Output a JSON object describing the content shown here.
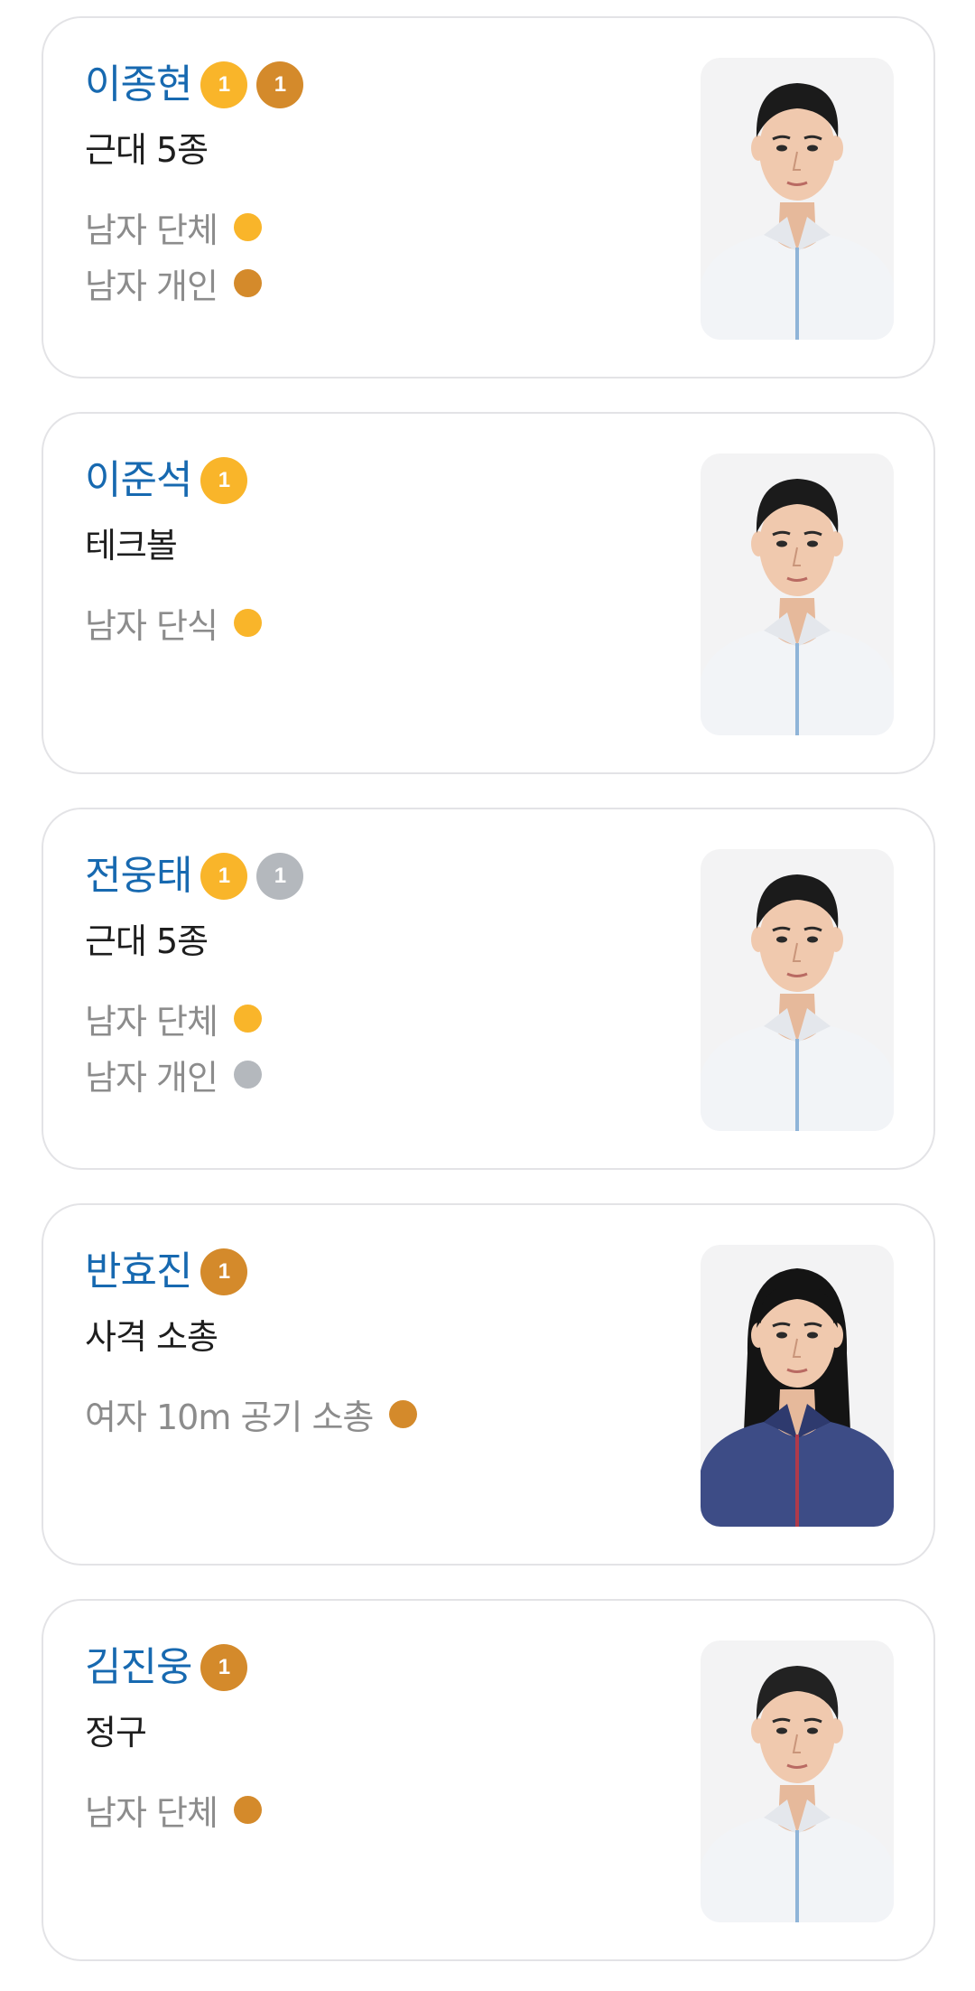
{
  "colors": {
    "gold": "#f9b52a",
    "silver": "#b4b8bd",
    "bronze": "#d48a2b",
    "name": "#1769b0"
  },
  "athletes": [
    {
      "name": "이종현",
      "sport": "근대 5종",
      "medals": [
        {
          "type": "gold",
          "count": "1"
        },
        {
          "type": "bronze",
          "count": "1"
        }
      ],
      "events": [
        {
          "name": "남자 단체",
          "medal": "gold"
        },
        {
          "name": "남자 개인",
          "medal": "bronze"
        }
      ],
      "photo": {
        "icon": "athlete-portrait",
        "hair": "#1b1b1b",
        "jacket": "#f2f4f7"
      }
    },
    {
      "name": "이준석",
      "sport": "테크볼",
      "medals": [
        {
          "type": "gold",
          "count": "1"
        }
      ],
      "events": [
        {
          "name": "남자 단식",
          "medal": "gold"
        }
      ],
      "photo": {
        "icon": "athlete-portrait",
        "hair": "#1b1b1b",
        "jacket": "#f2f4f7"
      }
    },
    {
      "name": "전웅태",
      "sport": "근대 5종",
      "medals": [
        {
          "type": "gold",
          "count": "1"
        },
        {
          "type": "silver",
          "count": "1"
        }
      ],
      "events": [
        {
          "name": "남자 단체",
          "medal": "gold"
        },
        {
          "name": "남자 개인",
          "medal": "silver"
        }
      ],
      "photo": {
        "icon": "athlete-portrait",
        "hair": "#1b1b1b",
        "jacket": "#f2f4f7"
      }
    },
    {
      "name": "반효진",
      "sport": "사격 소총",
      "medals": [
        {
          "type": "bronze",
          "count": "1"
        }
      ],
      "events": [
        {
          "name": "여자 10m 공기 소총",
          "medal": "bronze"
        }
      ],
      "photo": {
        "icon": "athlete-portrait",
        "hair": "#141414",
        "jacket": "#3d4c86",
        "long_hair": true
      }
    },
    {
      "name": "김진웅",
      "sport": "정구",
      "medals": [
        {
          "type": "bronze",
          "count": "1"
        }
      ],
      "events": [
        {
          "name": "남자 단체",
          "medal": "bronze"
        }
      ],
      "photo": {
        "icon": "athlete-portrait",
        "hair": "#222222",
        "jacket": "#f2f4f7"
      }
    }
  ]
}
